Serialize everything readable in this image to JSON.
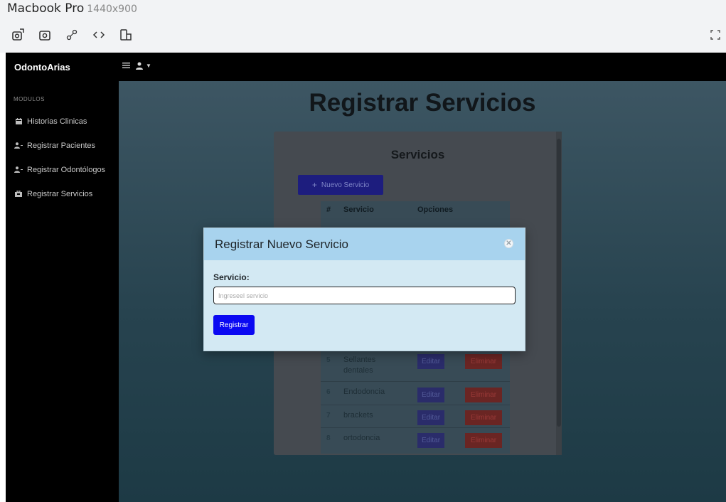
{
  "device": {
    "name": "Macbook Pro",
    "resolution": "1440x900",
    "tools": [
      {
        "icon": "screenshot-icon"
      },
      {
        "icon": "camera-icon"
      },
      {
        "icon": "touch-icon"
      },
      {
        "icon": "code-icon"
      },
      {
        "icon": "rotate-device-icon"
      }
    ],
    "fullscreen_icon": "fullscreen-icon"
  },
  "navbar": {
    "brand": "OdontoArias",
    "menu_icon": "hamburger-icon",
    "user_icon": "user-icon"
  },
  "sidebar": {
    "heading": "MODULOS",
    "items": [
      {
        "label": "Historias Clinicas",
        "icon": "calendar-icon"
      },
      {
        "label": "Registrar Pacientes",
        "icon": "user-plus-icon"
      },
      {
        "label": "Registrar Odontólogos",
        "icon": "user-plus-icon"
      },
      {
        "label": "Registrar Servicios",
        "icon": "briefcase-icon"
      }
    ]
  },
  "main": {
    "title": "Registrar Servicios",
    "card": {
      "title": "Servicios",
      "new_button": {
        "icon": "plus-icon",
        "label": "Nuevo Servicio"
      },
      "table": {
        "headers": [
          "#",
          "Servicio",
          "Opciones"
        ],
        "rows": [
          {
            "num": "5",
            "service": "Sellantes dentales",
            "edit": "Editar",
            "delete": "Eliminar"
          },
          {
            "num": "6",
            "service": "Endodoncia",
            "edit": "Editar",
            "delete": "Eliminar"
          },
          {
            "num": "7",
            "service": "brackets",
            "edit": "Editar",
            "delete": "Eliminar"
          },
          {
            "num": "8",
            "service": "ortodoncia",
            "edit": "Editar",
            "delete": "Eliminar"
          }
        ]
      }
    }
  },
  "modal": {
    "title": "Registrar Nuevo Servicio",
    "close_icon": "close-icon",
    "field_label": "Servicio:",
    "field_value": "",
    "field_placeholder": "Ingreseel servicio",
    "submit_label": "Registrar"
  },
  "colors": {
    "navbar": "#000000",
    "modal_header": "#a8d3ee",
    "modal_body": "#d3e9f3",
    "primary_button": "#0b09f2"
  }
}
